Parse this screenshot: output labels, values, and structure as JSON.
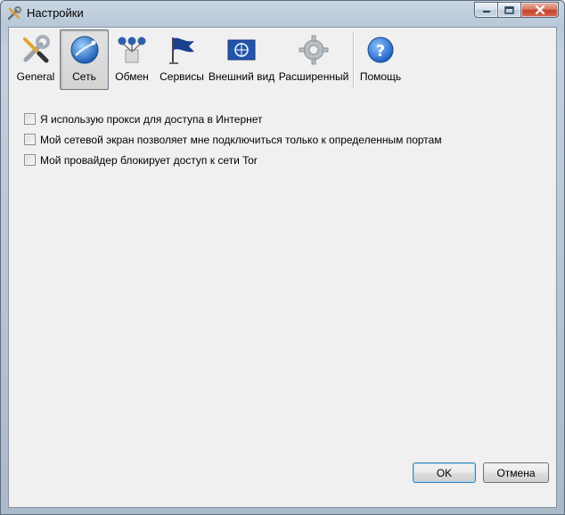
{
  "window": {
    "title": "Настройки",
    "title_icon": "tools-icon"
  },
  "toolbar": {
    "items": [
      {
        "label": "General",
        "icon": "wrench-screwdriver-icon",
        "selected": false
      },
      {
        "label": "Сеть",
        "icon": "network-globe-icon",
        "selected": true
      },
      {
        "label": "Обмен",
        "icon": "relay-nodes-icon",
        "selected": false
      },
      {
        "label": "Сервисы",
        "icon": "flag-icon",
        "selected": false
      },
      {
        "label": "Внешний вид",
        "icon": "un-flag-icon",
        "selected": false
      },
      {
        "label": "Расширенный",
        "icon": "gear-icon",
        "selected": false
      },
      {
        "label": "Помощь",
        "icon": "help-icon",
        "selected": false
      }
    ]
  },
  "network": {
    "options": [
      {
        "label": "Я использую прокси для доступа в Интернет",
        "checked": false
      },
      {
        "label": "Мой сетевой экран позволяет мне подключиться только к определенным портам",
        "checked": false
      },
      {
        "label": "Мой провайдер блокирует доступ к сети Tor",
        "checked": false
      }
    ]
  },
  "buttons": {
    "ok": "OK",
    "cancel": "Отмена"
  }
}
